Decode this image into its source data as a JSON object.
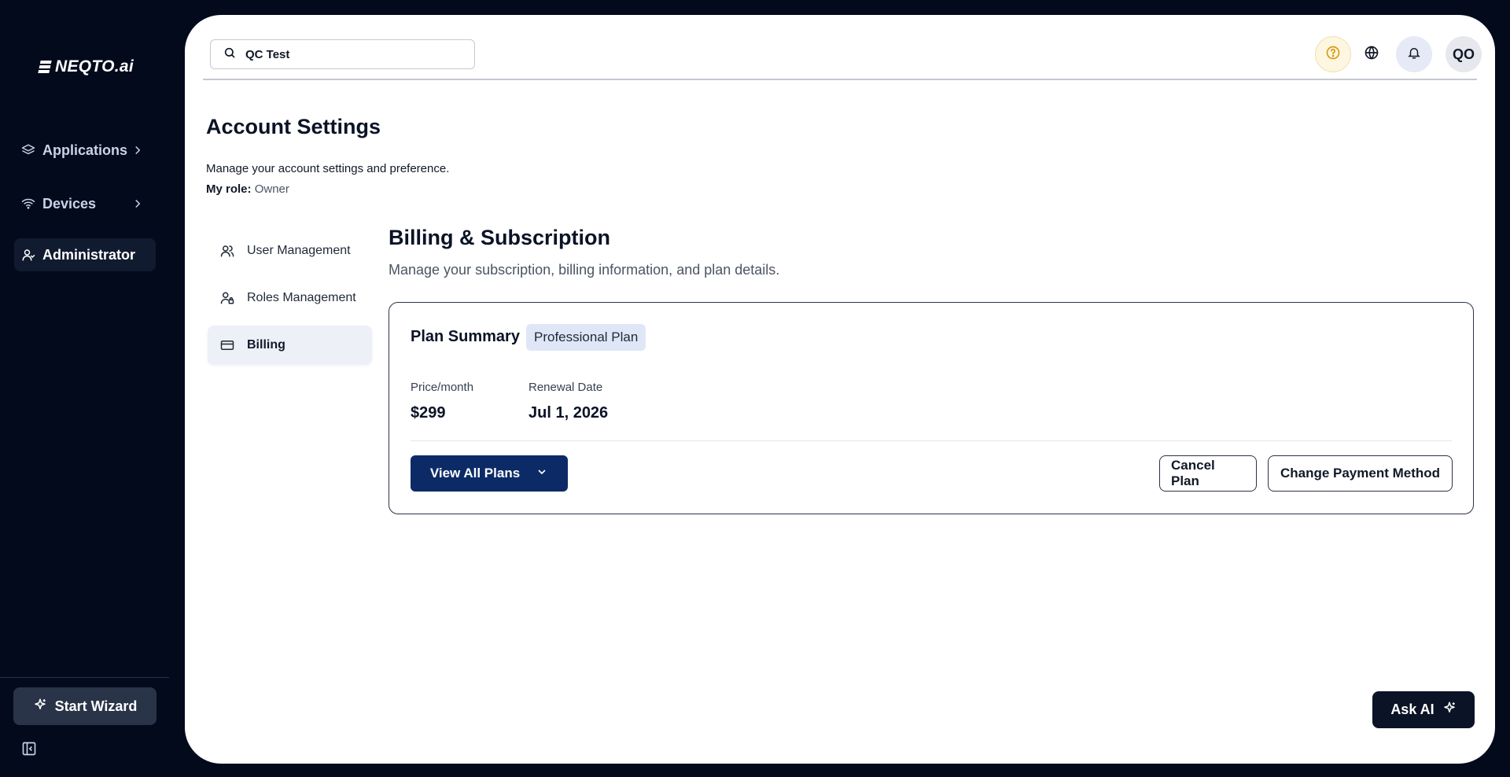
{
  "sidebar": {
    "logo_text": "NEQTO.ai",
    "items": [
      {
        "label": "Applications",
        "icon": "layers-icon"
      },
      {
        "label": "Devices",
        "icon": "wifi-icon"
      },
      {
        "label": "Administrator",
        "icon": "user-icon"
      }
    ],
    "wizard_label": "Start Wizard"
  },
  "header": {
    "search_value": "QC Test",
    "avatar_initials": "QO"
  },
  "page": {
    "title": "Account Settings",
    "description": "Manage your account settings and preference.",
    "role_label": "My role:",
    "role_value": "Owner"
  },
  "tabs": [
    {
      "label": "User Management",
      "icon": "users-icon"
    },
    {
      "label": "Roles Management",
      "icon": "user-lock-icon"
    },
    {
      "label": "Billing",
      "icon": "credit-card-icon",
      "active": true
    }
  ],
  "billing": {
    "title": "Billing & Subscription",
    "description": "Manage your subscription, billing information, and plan details.",
    "plan_summary_label": "Plan Summary",
    "plan_name": "Professional Plan",
    "price_label": "Price/month",
    "price_value": "$299",
    "renewal_label": "Renewal Date",
    "renewal_value": "Jul 1, 2026",
    "view_plans_label": "View All Plans",
    "cancel_label": "Cancel Plan",
    "change_payment_label": "Change Payment Method"
  },
  "ask_ai_label": "Ask AI",
  "colors": {
    "background": "#030a1c",
    "primary_button": "#0c2b66",
    "badge": "#dfe7f7"
  }
}
